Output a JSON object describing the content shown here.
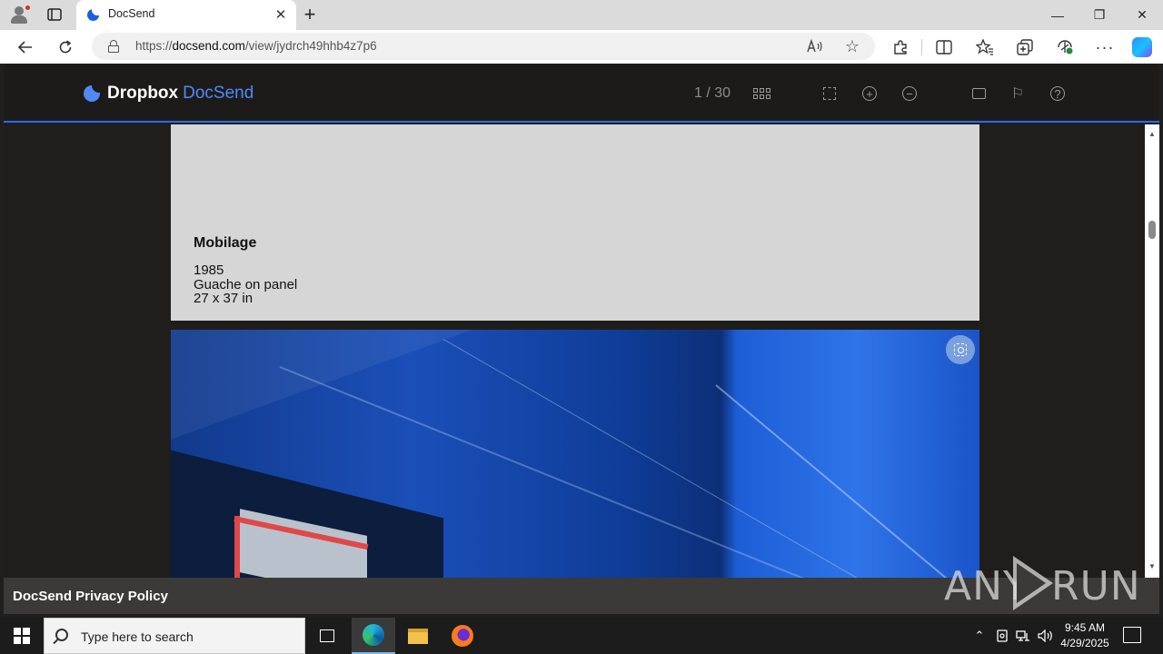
{
  "browser": {
    "tab": {
      "title": "DocSend",
      "close_glyph": "✕"
    },
    "new_tab_glyph": "+",
    "window_controls": {
      "minimize": "—",
      "maximize": "❐",
      "close": "✕"
    },
    "address": {
      "url_prefix": "https://",
      "url_host": "docsend.com",
      "url_path": "/view/jydrch49hhb4z7p6"
    },
    "toolbar_icons": [
      "extensions-icon",
      "split-screen-icon",
      "favorites-icon",
      "collections-icon",
      "browser-essentials-icon",
      "more-icon",
      "copilot-icon"
    ]
  },
  "docsend": {
    "logo": {
      "brand": "Dropbox",
      "product": "DocSend"
    },
    "page_indicator": "1 / 30",
    "icons": [
      "grid-icon",
      "fullscreen-icon",
      "zoom-in-icon",
      "zoom-out-icon",
      "comment-icon",
      "flag-icon",
      "help-icon"
    ],
    "zoom_in_glyph": "+",
    "zoom_out_glyph": "−",
    "help_glyph": "?",
    "flag_glyph": "⚐",
    "artwork": {
      "title": "Mobilage",
      "year": "1985",
      "medium": "Guache on panel",
      "size": "27 x 37 in"
    },
    "footer_link": "DocSend Privacy Policy",
    "scrollbar": {
      "up": "▲",
      "down": "▼"
    }
  },
  "watermark": {
    "left": "ANY",
    "right": "RUN"
  },
  "taskbar": {
    "search_placeholder": "Type here to search",
    "apps": [
      "task-view",
      "edge",
      "file-explorer",
      "firefox"
    ],
    "tray": {
      "chevron": "⌃",
      "time": "9:45 AM",
      "date": "4/29/2025"
    }
  }
}
